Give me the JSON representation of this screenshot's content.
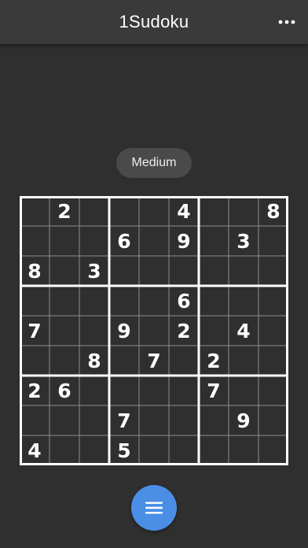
{
  "header": {
    "title": "1Sudoku",
    "more_icon": "more-horizontal-icon"
  },
  "difficulty": "Medium",
  "board": {
    "rows": [
      [
        "",
        "2",
        "",
        "",
        "",
        "4",
        "",
        "",
        "8"
      ],
      [
        "",
        "",
        "",
        "6",
        "",
        "9",
        "",
        "3",
        ""
      ],
      [
        "8",
        "",
        "3",
        "",
        "",
        "",
        "",
        "",
        ""
      ],
      [
        "",
        "",
        "",
        "",
        "",
        "6",
        "",
        "",
        ""
      ],
      [
        "7",
        "",
        "",
        "9",
        "",
        "2",
        "",
        "4",
        ""
      ],
      [
        "",
        "",
        "8",
        "",
        "7",
        "",
        "2",
        "",
        ""
      ],
      [
        "2",
        "6",
        "",
        "",
        "",
        "",
        "7",
        "",
        ""
      ],
      [
        "",
        "",
        "",
        "7",
        "",
        "",
        "",
        "9",
        ""
      ],
      [
        "4",
        "",
        "",
        "5",
        "",
        "",
        "",
        "",
        ""
      ]
    ]
  },
  "fab": {
    "icon": "menu-icon"
  },
  "colors": {
    "background": "#2f2f2f",
    "header": "#3a3a3a",
    "badge": "#4a4a4a",
    "grid_thick": "#ffffff",
    "grid_thin": "#8c8c8c",
    "accent": "#4a8ee6"
  }
}
